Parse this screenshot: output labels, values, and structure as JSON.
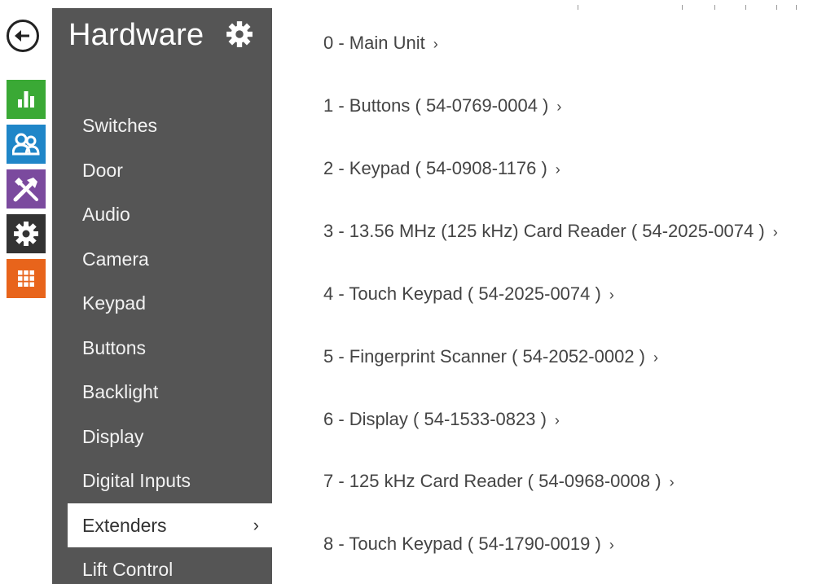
{
  "sidebar": {
    "title": "Hardware",
    "items": [
      {
        "label": "Switches"
      },
      {
        "label": "Door"
      },
      {
        "label": "Audio"
      },
      {
        "label": "Camera"
      },
      {
        "label": "Keypad"
      },
      {
        "label": "Buttons"
      },
      {
        "label": "Backlight"
      },
      {
        "label": "Display"
      },
      {
        "label": "Digital Inputs"
      },
      {
        "label": "Extenders",
        "active": true
      },
      {
        "label": "Lift Control"
      }
    ],
    "active_chevron": "›"
  },
  "rail": {
    "icons": [
      "back-arrow-icon",
      "bar-chart-icon",
      "users-icon",
      "tools-icon",
      "gear-icon",
      "grid-icon"
    ],
    "colors": {
      "green": "#3aa935",
      "blue": "#1f86c8",
      "purple": "#7b4a9e",
      "dark": "#333333",
      "orange": "#e8641b"
    }
  },
  "extenders": {
    "arrow": "›",
    "items": [
      {
        "label": "0 - Main Unit"
      },
      {
        "label": "1 - Buttons ( 54-0769-0004 )"
      },
      {
        "label": "2 - Keypad ( 54-0908-1176 )"
      },
      {
        "label": "3 - 13.56 MHz (125 kHz) Card Reader ( 54-2025-0074 )"
      },
      {
        "label": "4 - Touch Keypad ( 54-2025-0074 )"
      },
      {
        "label": "5 - Fingerprint Scanner ( 54-2052-0002 )"
      },
      {
        "label": "6 - Display ( 54-1533-0823 )"
      },
      {
        "label": "7 - 125 kHz Card Reader ( 54-0968-0008 )"
      },
      {
        "label": "8 - Touch Keypad ( 54-1790-0019 )"
      }
    ]
  }
}
